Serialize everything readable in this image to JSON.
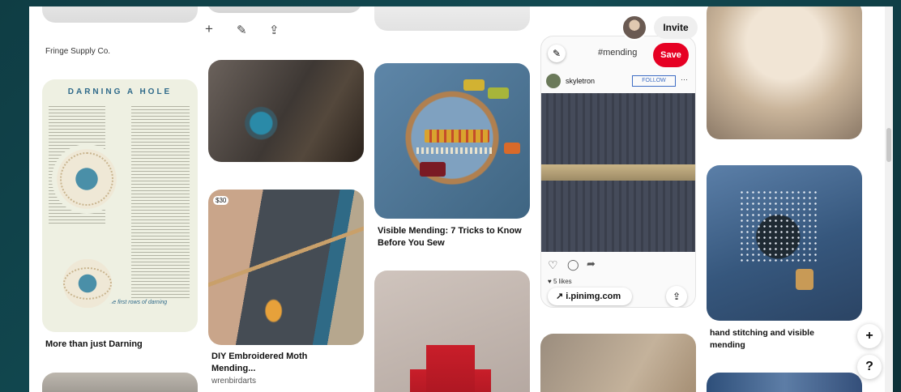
{
  "toolbar": {
    "add_icon": "+",
    "edit_icon": "✎",
    "share_icon": "⇪"
  },
  "header": {
    "invite_label": "Invite"
  },
  "col1": {
    "top_caption": "Fringe Supply Co.",
    "darning": {
      "heading": "DARNING A HOLE",
      "subheading": "Darning hose the first rows of darning"
    },
    "caption": "More than just Darning"
  },
  "col2": {
    "moth": {
      "price": "$30",
      "caption_line1": "DIY Embroidered Moth",
      "caption_line2": "Mending...",
      "author": "wrenbirdarts"
    }
  },
  "col3": {
    "hoop_caption_line1": "Visible Mending: 7 Tricks to Know",
    "hoop_caption_line2": "Before You Sew"
  },
  "col4": {
    "insta": {
      "hashtag": "#mending",
      "save_label": "Save",
      "username": "skyletron",
      "follow_label": "FOLLOW",
      "more": "···",
      "likes": "♥ 5 likes",
      "source_link": "↗ i.pinimg.com",
      "share_icon": "⇪"
    }
  },
  "col5": {
    "caption_line1": "hand stitching and visible",
    "caption_line2": "mending"
  },
  "fab": {
    "plus": "+",
    "help": "?"
  },
  "colors": {
    "save_red": "#e60023",
    "background": "#0f3d44",
    "follow_blue": "#3d6dc4"
  }
}
